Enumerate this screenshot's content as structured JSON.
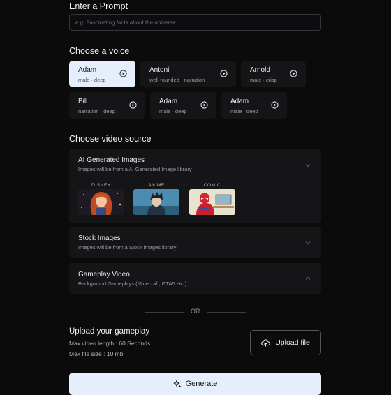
{
  "prompt": {
    "heading": "Enter a Prompt",
    "placeholder": "e.g. Fascinating facts about the universe.",
    "value": ""
  },
  "voice": {
    "heading": "Choose a voice",
    "options": [
      {
        "name": "Adam",
        "desc": "male · deep",
        "selected": true
      },
      {
        "name": "Antoni",
        "desc": "well-rounded · narration",
        "selected": false
      },
      {
        "name": "Arnold",
        "desc": "male · crisp",
        "selected": false
      },
      {
        "name": "Bill",
        "desc": "narration · deep",
        "selected": false
      },
      {
        "name": "Adam",
        "desc": "male · deep",
        "selected": false
      },
      {
        "name": "Adam",
        "desc": "male · deep",
        "selected": false
      }
    ]
  },
  "video_source": {
    "heading": "Choose video source",
    "options": [
      {
        "title": "AI Generated Images",
        "desc": "Images will be from a AI Generated Image library",
        "expanded": true,
        "styles": [
          "DISNEY",
          "ANIME",
          "COMIC"
        ]
      },
      {
        "title": "Stock Images",
        "desc": "Images will be from a Stock images library",
        "expanded": false
      },
      {
        "title": "Gameplay Video",
        "desc": "Background Gameplays (Minecraft, GTA5 etc.)",
        "expanded": true
      }
    ]
  },
  "divider": {
    "label": "OR"
  },
  "upload": {
    "heading": "Upload your gameplay",
    "max_length": "Max video length : 60 Seconds",
    "max_size": "Max file size : 10 mb",
    "button_label": "Upload file"
  },
  "generate": {
    "label": "Generate"
  },
  "colors": {
    "background": "#0b0b0c",
    "card": "#151518",
    "selected": "#e6eefc",
    "text": "#f2f2f4",
    "muted": "#9a9aa2"
  }
}
